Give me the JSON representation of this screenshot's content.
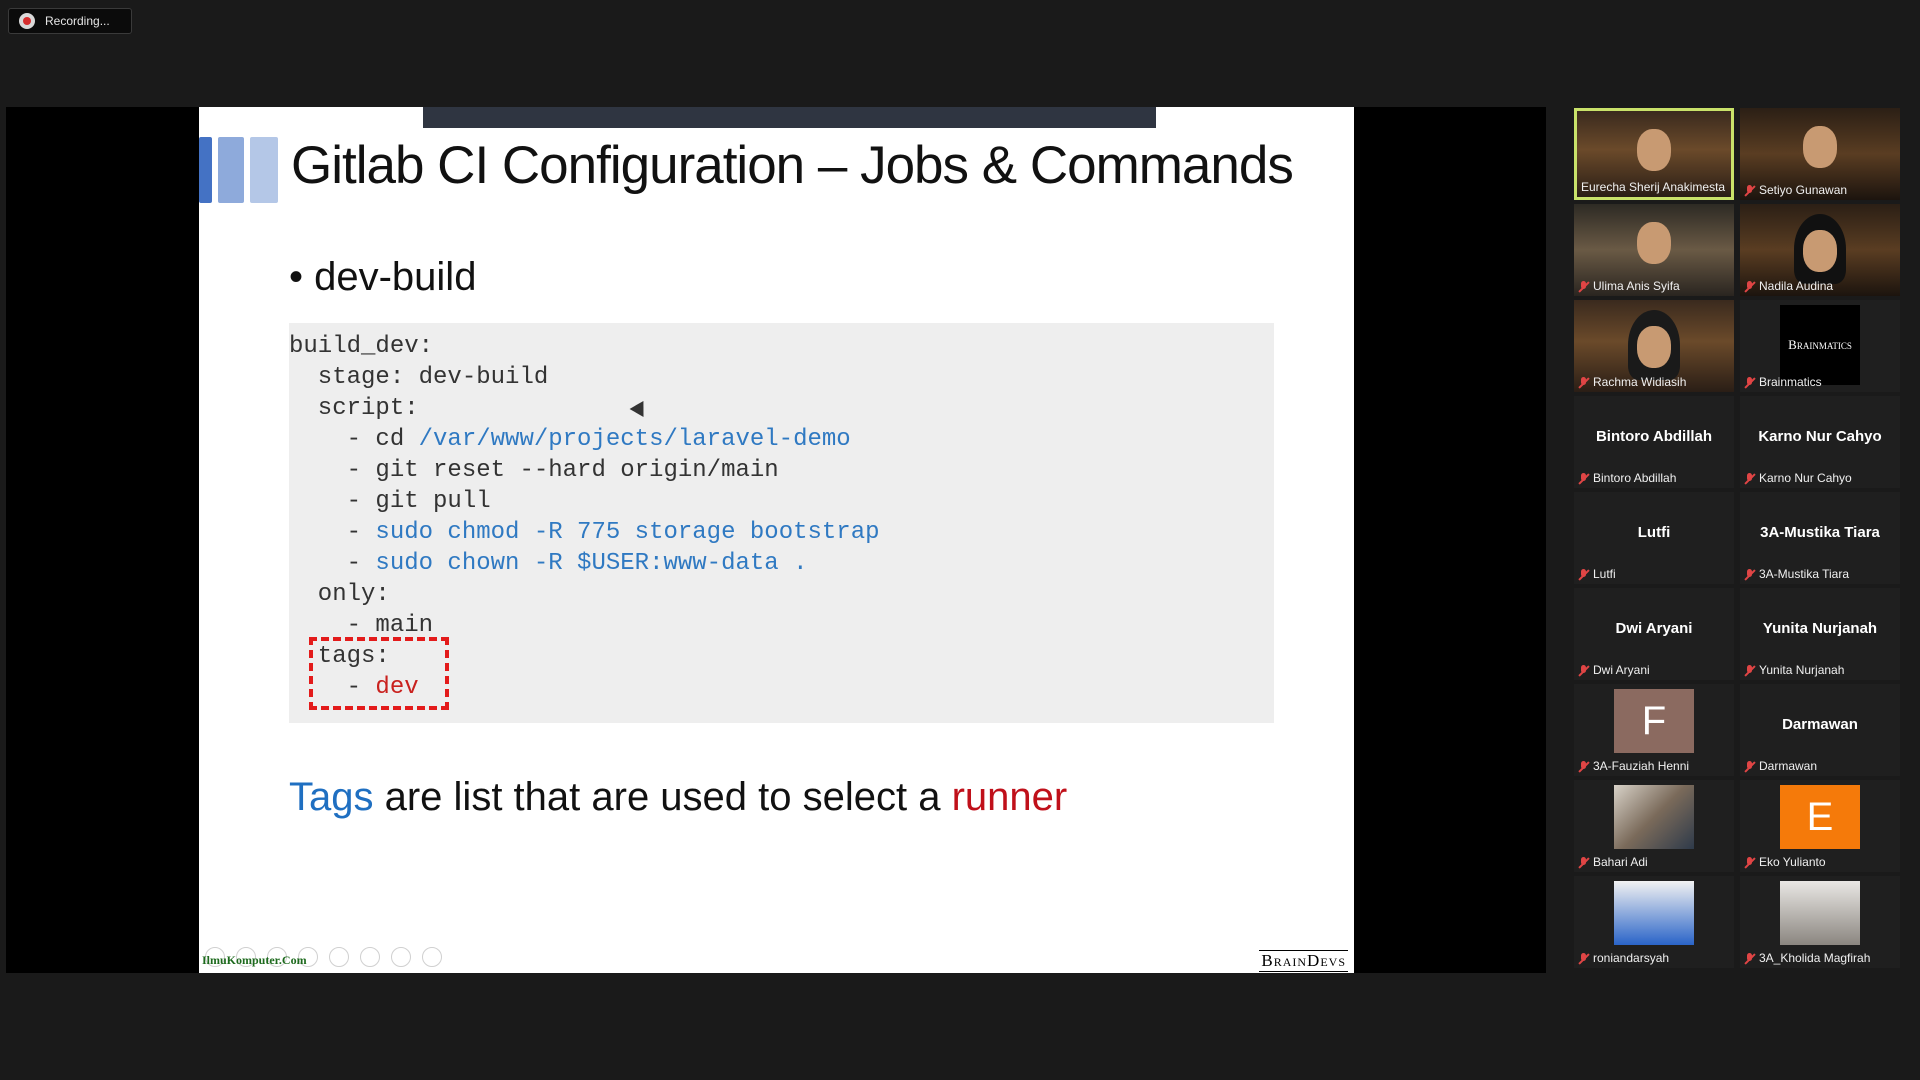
{
  "recording": {
    "label": "Recording..."
  },
  "slide": {
    "title": "Gitlab CI Configuration – Jobs & Commands",
    "bullet": "• dev-build",
    "code": {
      "l1": "build_dev:",
      "l2": "  stage: dev-build",
      "l3": "  script:",
      "l4_prefix": "    - cd ",
      "l4_path": "/var/www/projects/laravel-demo",
      "l5": "    - git reset --hard origin/main",
      "l6": "    - git pull",
      "l7_prefix": "    - ",
      "l7_cmd": "sudo chmod -R 775 storage bootstrap",
      "l8_prefix": "    - ",
      "l8_cmd": "sudo chown -R $USER:www-data .",
      "l9": "  only:",
      "l10": "    - main",
      "l11": "  tags:",
      "l12_prefix": "    - ",
      "l12_val": "dev"
    },
    "caption": {
      "word1": "Tags",
      "middle": " are list that are used to select a ",
      "word2": "runner"
    },
    "footer_left": "IlmuKomputer.Com",
    "footer_right": "BrainDevs"
  },
  "participants": [
    {
      "name": "Eurecha Sherij Anakimesta",
      "active": true,
      "muted": false,
      "kind": "video"
    },
    {
      "name": "Setiyo Gunawan",
      "muted": true,
      "kind": "video"
    },
    {
      "name": "Ulima Anis Syifa",
      "muted": true,
      "kind": "video"
    },
    {
      "name": "Nadila Audina",
      "muted": true,
      "kind": "video"
    },
    {
      "name": "Rachma Widiasih",
      "muted": true,
      "kind": "video"
    },
    {
      "name": "Brainmatics",
      "muted": true,
      "kind": "logo",
      "logo_text": "Brainmatics"
    },
    {
      "name": "Bintoro Abdillah",
      "muted": true,
      "kind": "name"
    },
    {
      "name": "Karno Nur Cahyo",
      "muted": true,
      "kind": "name"
    },
    {
      "name": "Lutfi",
      "muted": true,
      "kind": "name"
    },
    {
      "name": "3A-Mustika Tiara",
      "muted": true,
      "kind": "name"
    },
    {
      "name": "Dwi Aryani",
      "muted": true,
      "kind": "name"
    },
    {
      "name": "Yunita Nurjanah",
      "muted": true,
      "kind": "name"
    },
    {
      "name": "3A-Fauziah Henni",
      "muted": true,
      "kind": "initial",
      "initial": "F",
      "color": "#8b6a60"
    },
    {
      "name": "Darmawan",
      "muted": true,
      "kind": "name"
    },
    {
      "name": "Bahari Adi",
      "muted": true,
      "kind": "photo"
    },
    {
      "name": "Eko Yulianto",
      "muted": true,
      "kind": "initial",
      "initial": "E",
      "color": "#f57a0a"
    },
    {
      "name": "roniandarsyah",
      "muted": true,
      "kind": "photo"
    },
    {
      "name": "3A_Kholida Magfirah",
      "muted": true,
      "kind": "photo"
    }
  ]
}
